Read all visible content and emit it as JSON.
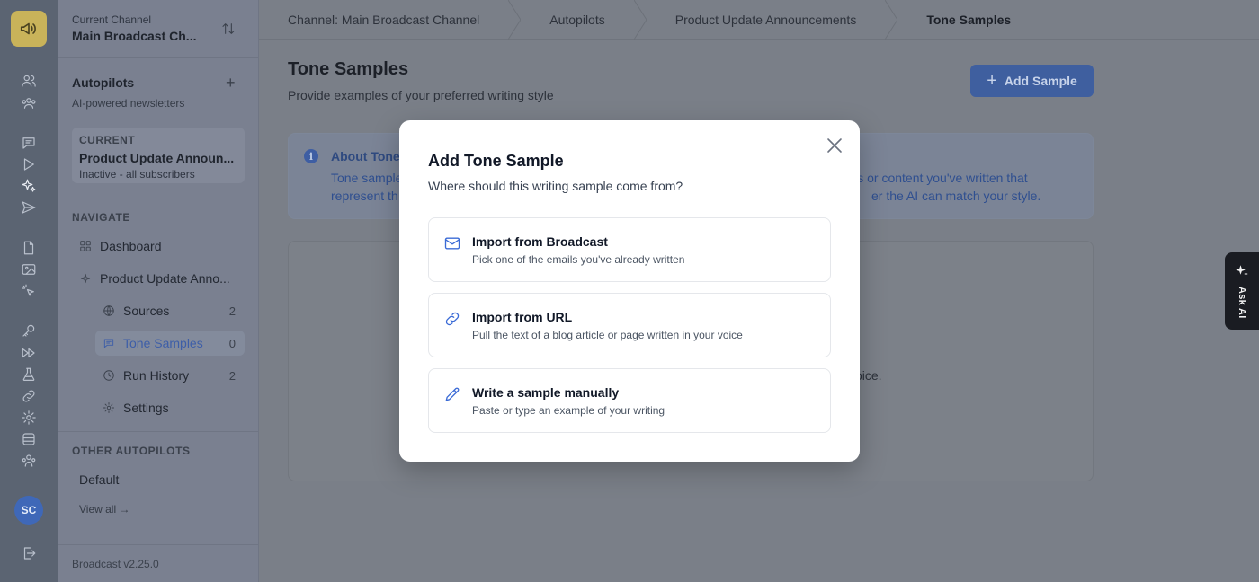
{
  "sidebar": {
    "channel_label": "Current Channel",
    "channel_name": "Main Broadcast Ch...",
    "autopilots_title": "Autopilots",
    "autopilots_sub": "AI-powered newsletters",
    "current_label": "CURRENT",
    "current_name": "Product Update Announ...",
    "current_sub": "Inactive - all subscribers",
    "navigate_label": "NAVIGATE",
    "nav": {
      "dashboard": "Dashboard",
      "autopilot": "Product Update Anno...",
      "sources": "Sources",
      "sources_count": "2",
      "tone": "Tone Samples",
      "tone_count": "0",
      "history": "Run History",
      "history_count": "2",
      "settings": "Settings"
    },
    "other_label": "OTHER AUTOPILOTS",
    "other_item": "Default",
    "view_all": "View all →",
    "version": "Broadcast v2.25.0"
  },
  "rail": {
    "avatar": "SC"
  },
  "breadcrumbs": [
    "Channel: Main Broadcast Channel",
    "Autopilots",
    "Product Update Announcements",
    "Tone Samples"
  ],
  "page": {
    "title": "Tone Samples",
    "subtitle": "Provide examples of your preferred writing style",
    "add_button": "Add Sample",
    "info_title": "About Tone",
    "info_line1_a": "Tone sample",
    "info_line1_b": "ils or content you've written that",
    "info_line2_a": "represent th",
    "info_line2_b": "er the AI can match your style.",
    "empty_tail": "oice."
  },
  "ask_ai": "Ask AI",
  "modal": {
    "title": "Add Tone Sample",
    "subtitle": "Where should this writing sample come from?",
    "options": [
      {
        "title": "Import from Broadcast",
        "desc": "Pick one of the emails you've already written",
        "icon": "mail-icon"
      },
      {
        "title": "Import from URL",
        "desc": "Pull the text of a blog article or page written in your voice",
        "icon": "link-icon"
      },
      {
        "title": "Write a sample manually",
        "desc": "Paste or type an example of your writing",
        "icon": "pencil-icon"
      }
    ]
  },
  "colors": {
    "accent": "#3b6bd6",
    "overlay": "#7a7f88",
    "modal_bg": "#ffffff"
  }
}
